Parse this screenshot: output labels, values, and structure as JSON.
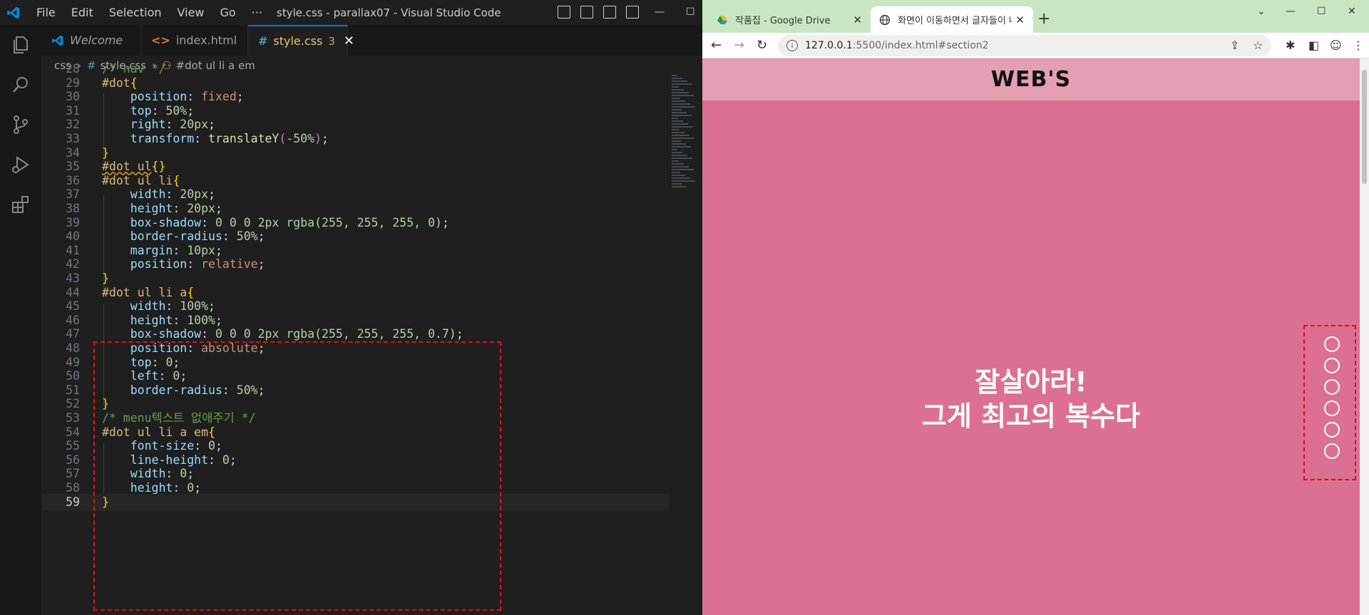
{
  "vscode": {
    "menu": [
      "File",
      "Edit",
      "Selection",
      "View",
      "Go",
      "···"
    ],
    "window_title": "style.css - parallax07 - Visual Studio Code",
    "tabs": [
      {
        "label": "Welcome",
        "icon": "vscode-logo-icon"
      },
      {
        "label": "index.html",
        "icon": "html-icon"
      },
      {
        "label": "style.css",
        "icon": "css-hash-icon",
        "badge": "3",
        "active": true
      }
    ],
    "breadcrumb": {
      "folder": "css",
      "file": "style.css",
      "symbol": "#dot ul li a em"
    },
    "lines": [
      {
        "n": "28",
        "text": "/* nav */"
      },
      {
        "n": "29",
        "text": "#dot{"
      },
      {
        "n": "30",
        "text": "position: fixed;"
      },
      {
        "n": "31",
        "text": "top: 50%;"
      },
      {
        "n": "32",
        "text": "right: 20px;"
      },
      {
        "n": "33",
        "text": "transform: translateY(-50%);"
      },
      {
        "n": "34",
        "text": "}"
      },
      {
        "n": "35",
        "text": "#dot ul{}"
      },
      {
        "n": "36",
        "text": "#dot ul li{"
      },
      {
        "n": "37",
        "text": "width: 20px;"
      },
      {
        "n": "38",
        "text": "height: 20px;"
      },
      {
        "n": "39",
        "text": "box-shadow: 0 0 0 2px rgba(255, 255, 255, 0);"
      },
      {
        "n": "40",
        "text": "border-radius: 50%;"
      },
      {
        "n": "41",
        "text": "margin: 10px;"
      },
      {
        "n": "42",
        "text": "position: relative;"
      },
      {
        "n": "43",
        "text": "}"
      },
      {
        "n": "44",
        "text": "#dot ul li a{"
      },
      {
        "n": "45",
        "text": "width: 100%;"
      },
      {
        "n": "46",
        "text": "height: 100%;"
      },
      {
        "n": "47",
        "text": "box-shadow: 0 0 0 2px rgba(255, 255, 255, 0.7);"
      },
      {
        "n": "48",
        "text": "position: absolute;"
      },
      {
        "n": "49",
        "text": "top: 0;"
      },
      {
        "n": "50",
        "text": "left: 0;"
      },
      {
        "n": "51",
        "text": "border-radius: 50%;"
      },
      {
        "n": "52",
        "text": "}"
      },
      {
        "n": "53",
        "text": "/* menu텍스트 없애주기 */"
      },
      {
        "n": "54",
        "text": "#dot ul li a em{"
      },
      {
        "n": "55",
        "text": "font-size: 0;"
      },
      {
        "n": "56",
        "text": "line-height: 0;"
      },
      {
        "n": "57",
        "text": "width: 0;"
      },
      {
        "n": "58",
        "text": "height: 0;"
      },
      {
        "n": "59",
        "text": "}"
      }
    ],
    "current_line": "59"
  },
  "browser": {
    "tabs": [
      {
        "label": "작품집 - Google Drive",
        "icon": "google-drive-icon"
      },
      {
        "label": "화면이 이동하면서 글자들이 나오",
        "icon": "globe-icon",
        "active": true
      }
    ],
    "url_host": "127.0.0.1",
    "url_path": ":5500/index.html#section2",
    "page": {
      "logo": "WEB'S",
      "hero_line1": "잘살아라!",
      "hero_line2": "그게 최고의 복수다",
      "dot_count": 6
    },
    "colors": {
      "section_bg": "#dc7092",
      "header_bg": "#e59fb3",
      "tab_strip": "#c9e6c2"
    }
  }
}
